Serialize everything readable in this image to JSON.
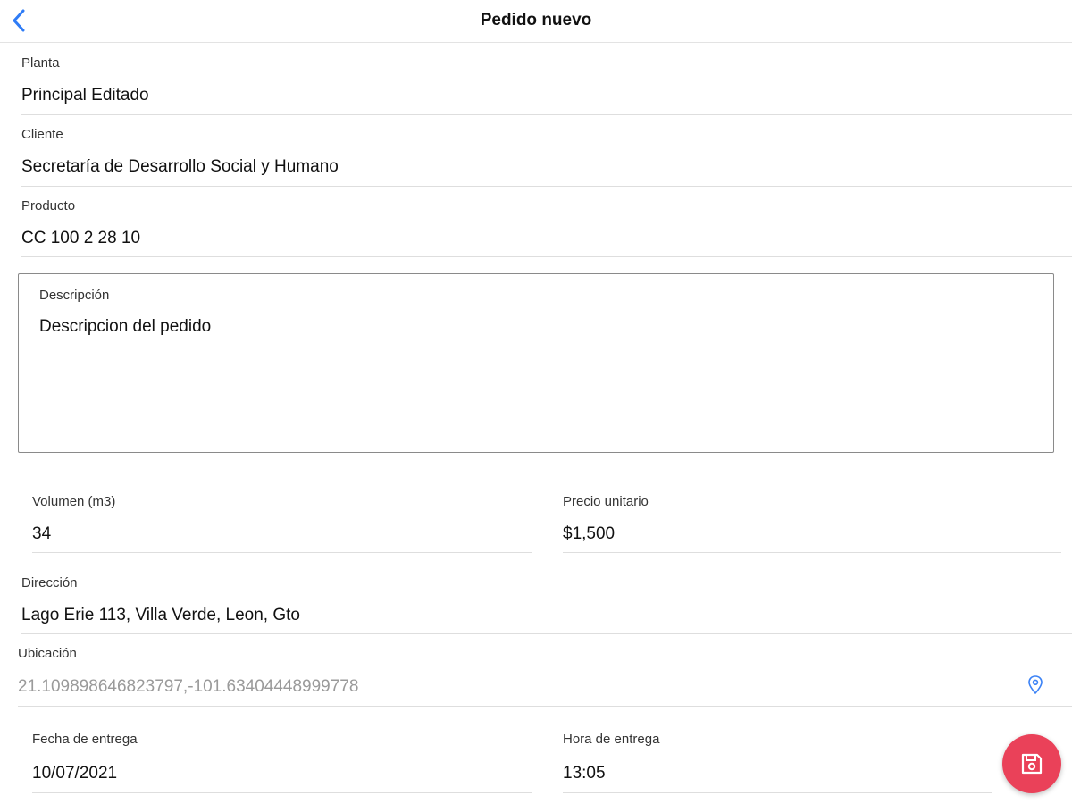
{
  "header": {
    "title": "Pedido nuevo",
    "back_icon": "chevron-left-icon",
    "accent_color": "#2f7cf6"
  },
  "form": {
    "planta": {
      "label": "Planta",
      "value": "Principal Editado"
    },
    "cliente": {
      "label": "Cliente",
      "value": "Secretaría de Desarrollo Social y Humano"
    },
    "producto": {
      "label": "Producto",
      "value": "CC 100 2 28 10"
    },
    "descripcion": {
      "label": "Descripción",
      "value": "Descripcion del pedido"
    },
    "volumen": {
      "label": "Volumen (m3)",
      "value": "34"
    },
    "precio": {
      "label": "Precio unitario",
      "value": "$1,500"
    },
    "direccion": {
      "label": "Dirección",
      "value": "Lago Erie 113, Villa Verde, Leon, Gto"
    },
    "ubicacion": {
      "label": "Ubicación",
      "value": "21.109898646823797,-101.63404448999778",
      "icon": "map-pin-icon"
    },
    "fecha": {
      "label": "Fecha de entrega",
      "value": "10/07/2021"
    },
    "hora": {
      "label": "Hora de entrega",
      "value": "13:05"
    }
  },
  "fab": {
    "icon": "save-icon",
    "color": "#ea4159"
  }
}
